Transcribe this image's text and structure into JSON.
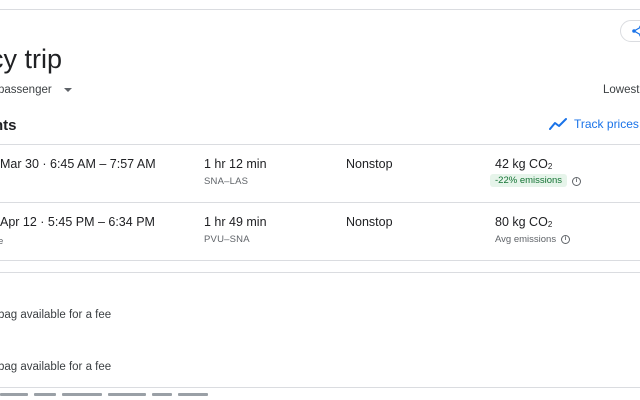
{
  "header": {
    "title": "cy trip",
    "passenger": "passenger",
    "sort": "Lowest",
    "share_icon": "share-icon"
  },
  "section": {
    "title": "nts",
    "track_label": "Track prices",
    "track_icon": "trend-line-icon"
  },
  "flights": [
    {
      "times": "Mar 30  ·  6:45 AM – 7:57 AM",
      "sub": "",
      "duration": "1 hr 12 min",
      "route": "SNA–LAS",
      "stops": "Nonstop",
      "co2_value": "42 kg CO",
      "co2_sub": "2",
      "emissions": "-22% emissions"
    },
    {
      "times": "Apr 12  ·  5:45 PM – 6:34 PM",
      "sub": "e",
      "duration": "1 hr 49 min",
      "route": "PVU–SNA",
      "stops": "Nonstop",
      "co2_value": "80 kg CO",
      "co2_sub": "2",
      "emissions": "Avg emissions"
    }
  ],
  "baggage": [
    "bag available for a fee",
    "bag available for a fee"
  ],
  "colors": {
    "accent": "#1a73e8",
    "green_text": "#137333",
    "green_bg": "#e6f4ea",
    "divider": "#dadce0"
  }
}
